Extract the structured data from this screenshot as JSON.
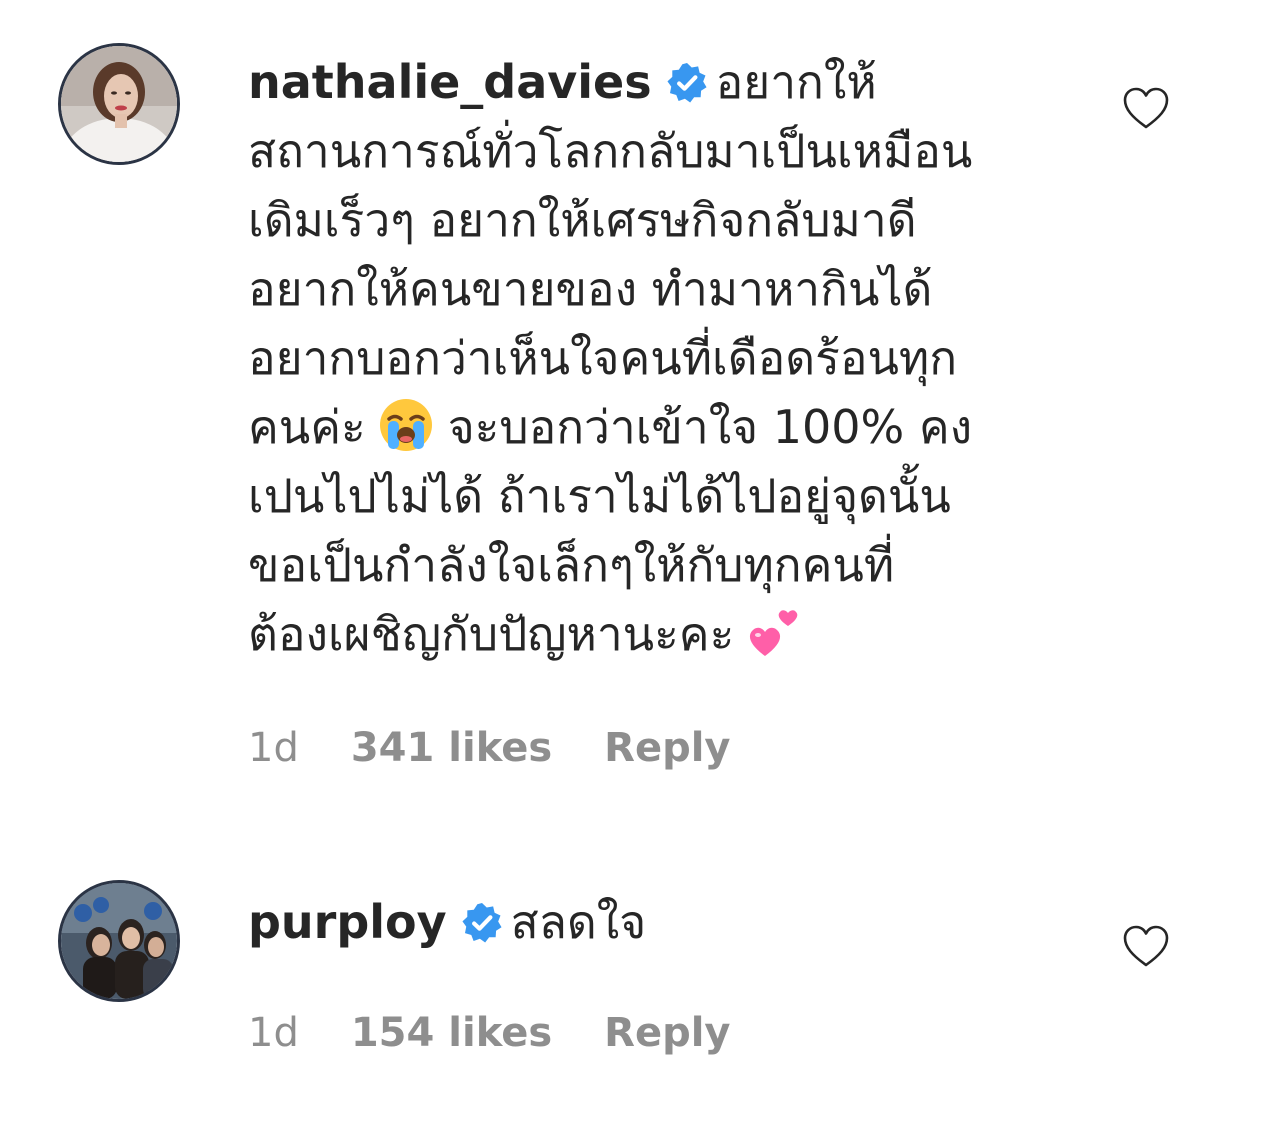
{
  "comments": [
    {
      "username": "nathalie_davies",
      "verified": true,
      "text_part1": "อยากให้\nสถานการณ์ทั่วโลกกลับมาเป็นเหมือน\nเดิมเร็วๆ อยากให้เศรษกิจกลับมาดี\nอยากให้คนขายของ ทำมาหากินได้\nอยากบอกว่าเห็นใจคนที่เดือดร้อนทุก\nคนค่ะ",
      "emoji_1": "loudly-crying-face-emoji",
      "text_part2": "จะบอกว่าเข้าใจ 100% คง\nเปนไปไม่ได้ ถ้าเราไม่ได้ไปอยู่จุดนั้น\nขอเป็นกำลังใจเล็กๆให้กับทุกคนที่\nต้องเผชิญกับปัญหานะคะ",
      "emoji_2": "two-hearts-emoji",
      "time": "1d",
      "likes": "341 likes",
      "reply": "Reply",
      "heart_icon": "heart-outline-icon"
    },
    {
      "username": "purploy",
      "verified": true,
      "text": "สลดใจ",
      "time": "1d",
      "likes": "154 likes",
      "reply": "Reply",
      "heart_icon": "heart-outline-icon"
    }
  ],
  "colors": {
    "text": "#262626",
    "secondary": "#8e8e8e",
    "verified": "#3897f0",
    "emoji_heart": "#ff5fa8"
  }
}
